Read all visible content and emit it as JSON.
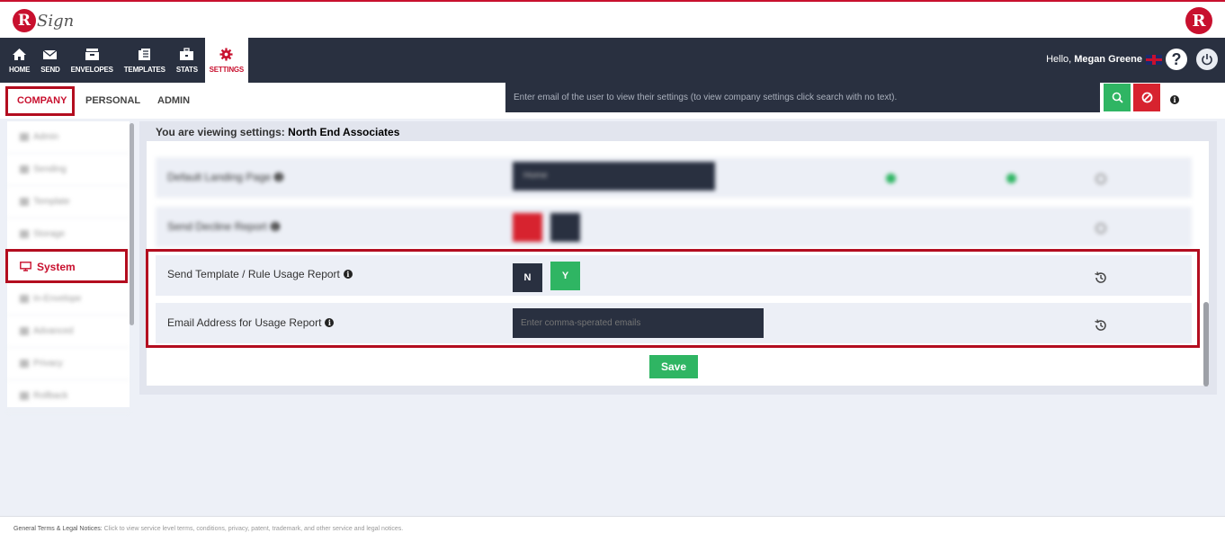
{
  "header": {
    "logo_letter": "R",
    "logo_text": "Sign",
    "logo_right_letter": "R"
  },
  "nav": {
    "items": [
      {
        "label": "HOME",
        "icon": "home-icon"
      },
      {
        "label": "SEND",
        "icon": "envelope-icon"
      },
      {
        "label": "ENVELOPES",
        "icon": "inbox-icon"
      },
      {
        "label": "TEMPLATES",
        "icon": "templates-icon"
      },
      {
        "label": "STATS",
        "icon": "briefcase-icon"
      },
      {
        "label": "SETTINGS",
        "icon": "gear-icon",
        "active": true
      }
    ],
    "greeting": "Hello,",
    "user_name": "Megan Greene",
    "help_symbol": "?"
  },
  "subtabs": [
    {
      "label": "COMPANY",
      "active": true
    },
    {
      "label": "PERSONAL"
    },
    {
      "label": "ADMIN"
    }
  ],
  "search": {
    "placeholder": "Enter email of the user to view their settings (to view company settings click search with no text)."
  },
  "sidebar": {
    "items": [
      {
        "label": "Admin"
      },
      {
        "label": "Sending"
      },
      {
        "label": "Template"
      },
      {
        "label": "Storage"
      },
      {
        "label": "System",
        "active": true
      },
      {
        "label": "In-Envelope"
      },
      {
        "label": "Advanced"
      },
      {
        "label": "Privacy"
      },
      {
        "label": "Rollback"
      }
    ]
  },
  "main": {
    "viewing_prefix": "You are viewing settings:",
    "company_name": "North End Associates",
    "blurred_rows": [
      {
        "label": "Default Landing Page",
        "select_value": "Home"
      },
      {
        "label": "Send Decline Report"
      }
    ],
    "rows": [
      {
        "label": "Send Template / Rule Usage Report",
        "n_label": "N",
        "y_label": "Y",
        "selected": "Y"
      },
      {
        "label": "Email Address for Usage Report",
        "placeholder": "Enter comma-sperated emails"
      }
    ],
    "save_label": "Save"
  },
  "footer": {
    "title": "General Terms & Legal Notices:",
    "text": "Click to view service level terms, conditions, privacy, patent, trademark, and other service and legal notices."
  },
  "colors": {
    "brand_red": "#c8102e",
    "navbar": "#293040",
    "green": "#2fb563",
    "highlight": "#b30d1f"
  }
}
